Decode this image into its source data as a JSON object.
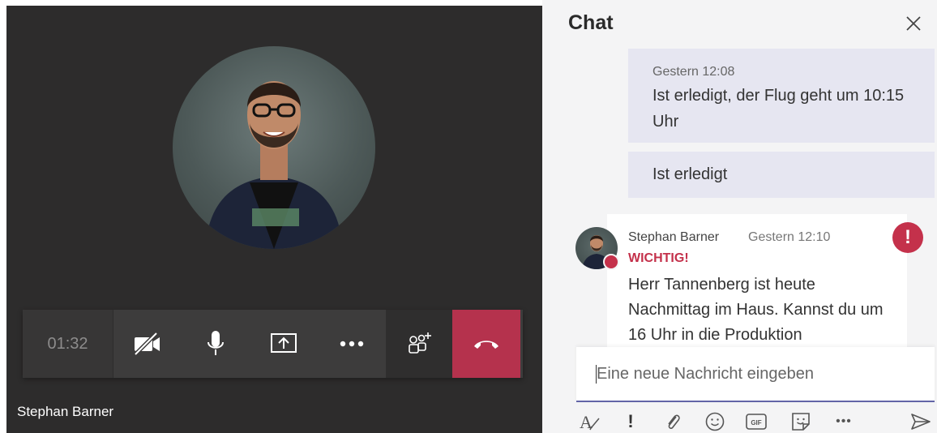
{
  "call": {
    "timer": "01:32",
    "caller_name": "Stephan Barner",
    "controls": [
      "video-off",
      "microphone",
      "share-screen",
      "more",
      "participants",
      "hang-up"
    ]
  },
  "chat": {
    "title": "Chat",
    "messages_sent": [
      {
        "time": "Gestern 12:08",
        "text": "Ist erledigt, der Flug geht um 10:15 Uhr"
      },
      {
        "time": "",
        "text": "Ist erledigt"
      }
    ],
    "message_received": {
      "sender": "Stephan Barner",
      "time": "Gestern 12:10",
      "flag": "WICHTIG!",
      "text": "Herr Tannenberg ist heute Nachmittag im Haus. Kannst du um 16 Uhr in die Produktion",
      "urgent_mark": "!"
    },
    "compose": {
      "placeholder": "Eine neue Nachricht eingeben"
    },
    "tools": {
      "format": "A",
      "important": "!",
      "gif": "GIF",
      "more": "•••"
    }
  },
  "colors": {
    "stage_bg": "#2d2c2c",
    "toolbar_bg": "#3d3c3c",
    "hangup": "#b5324d",
    "accent": "#6264a7",
    "urgent": "#c4314b",
    "bubble_me": "#e6e6f1"
  }
}
